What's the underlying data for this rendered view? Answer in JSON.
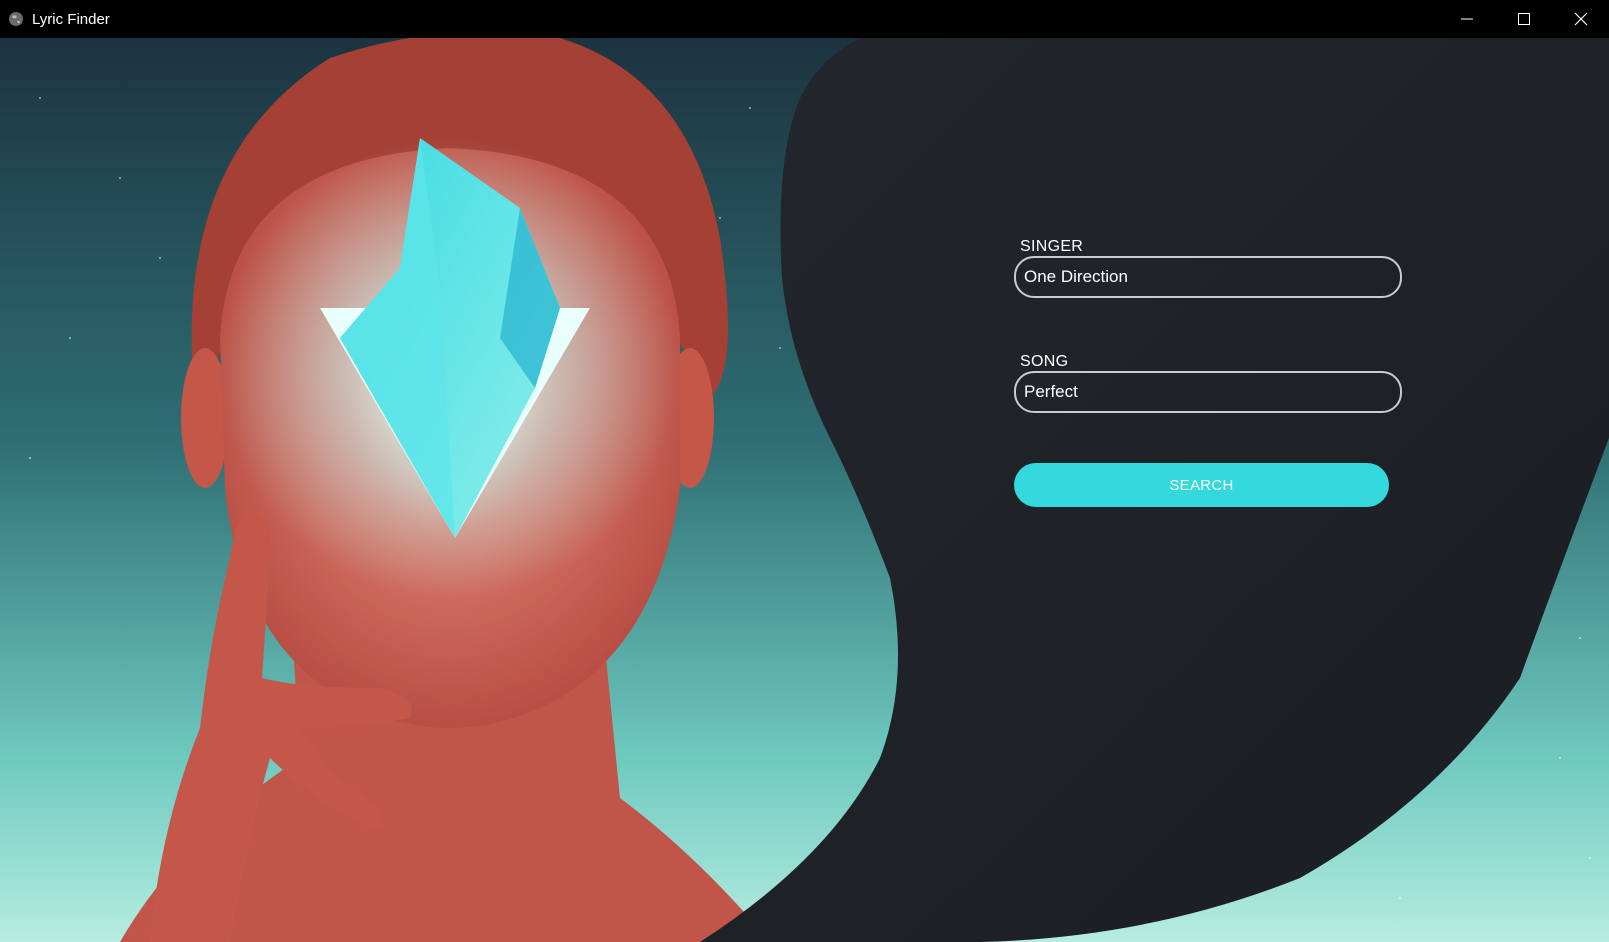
{
  "window": {
    "title": "Lyric Finder",
    "controls": [
      "minimize",
      "maximize",
      "close"
    ]
  },
  "form": {
    "singer_label": "SINGER",
    "singer_value": "One Direction",
    "song_label": "SONG",
    "song_value": "Perfect",
    "search_label": "SEARCH"
  },
  "colors": {
    "accent": "#33d9dc",
    "panel": "#1d2025",
    "titlebar": "#000000",
    "skin": "#c85a4a",
    "teal": "#5fc6c0"
  },
  "icons": {
    "app": "globe-icon",
    "minimize": "minimize-icon",
    "maximize": "maximize-icon",
    "close": "close-icon"
  }
}
